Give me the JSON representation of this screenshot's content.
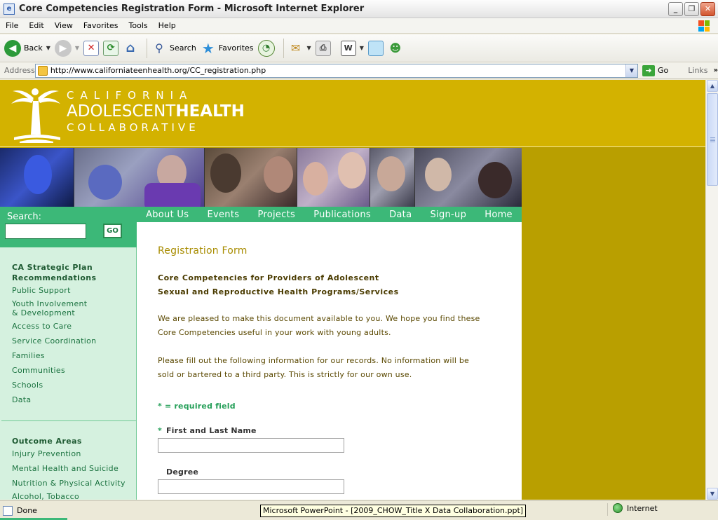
{
  "window": {
    "title": "Core Competencies Registration Form - Microsoft Internet Explorer",
    "app_icon": "ie-page-icon"
  },
  "menu": [
    "File",
    "Edit",
    "View",
    "Favorites",
    "Tools",
    "Help"
  ],
  "toolbar": {
    "back": "Back",
    "search": "Search",
    "favorites": "Favorites"
  },
  "address": {
    "label": "Address",
    "url": "http://www.californiateenhealth.org/CC_registration.php",
    "go": "Go",
    "links": "Links",
    "links_chevron": "»"
  },
  "site": {
    "logo": {
      "line1": "CALIFORNIA",
      "line2a": "ADOLESCENT",
      "line2b": "HEALTH",
      "line3": "COLLABORATIVE"
    },
    "nav": [
      "About Us",
      "Events",
      "Projects",
      "Publications",
      "Data",
      "Sign-up",
      "Home"
    ],
    "search": {
      "label": "Search:",
      "value": "",
      "go": "GO"
    },
    "sidebar": {
      "section1_title_line1": "CA Strategic Plan",
      "section1_title_line2": "Recommendations",
      "section1_links": [
        "Public Support",
        "Youth Involvement",
        "& Development",
        "Access to Care",
        "Service Coordination",
        "Families",
        "Communities",
        "Schools",
        "Data"
      ],
      "section2_title": "Outcome Areas",
      "section2_links": [
        "Injury Prevention",
        "Mental Health and Suicide",
        "Nutrition & Physical Activity",
        "Alcohol, Tobacco"
      ]
    },
    "content": {
      "title": "Registration Form",
      "subtitle_line1": "Core Competencies for Providers of Adolescent",
      "subtitle_line2": "Sexual and Reproductive Health Programs/Services",
      "para1_line1": "We are pleased to make this document available to you. We hope you find these",
      "para1_line2": "Core Competencies useful in your work with young adults.",
      "para2_line1": "Please fill out the following information for our records. No information will be",
      "para2_line2": "sold or bartered to a third party. This is strictly for our own use.",
      "required_note": "* = required field",
      "required_star": "*",
      "field_name_label": "First and Last Name",
      "field_name_value": "",
      "field_degree_label": "Degree",
      "field_degree_value": ""
    }
  },
  "status": {
    "text": "Done",
    "zone": "Internet",
    "tooltip": "Microsoft PowerPoint - [2009_CHOW_Title X Data Collaboration.ppt]"
  },
  "colors": {
    "header_gold": "#d3b200",
    "page_olive": "#b99f00",
    "nav_green": "#3cb878",
    "sidebar_mint": "#d5f1df",
    "title_gold": "#a88c00"
  }
}
